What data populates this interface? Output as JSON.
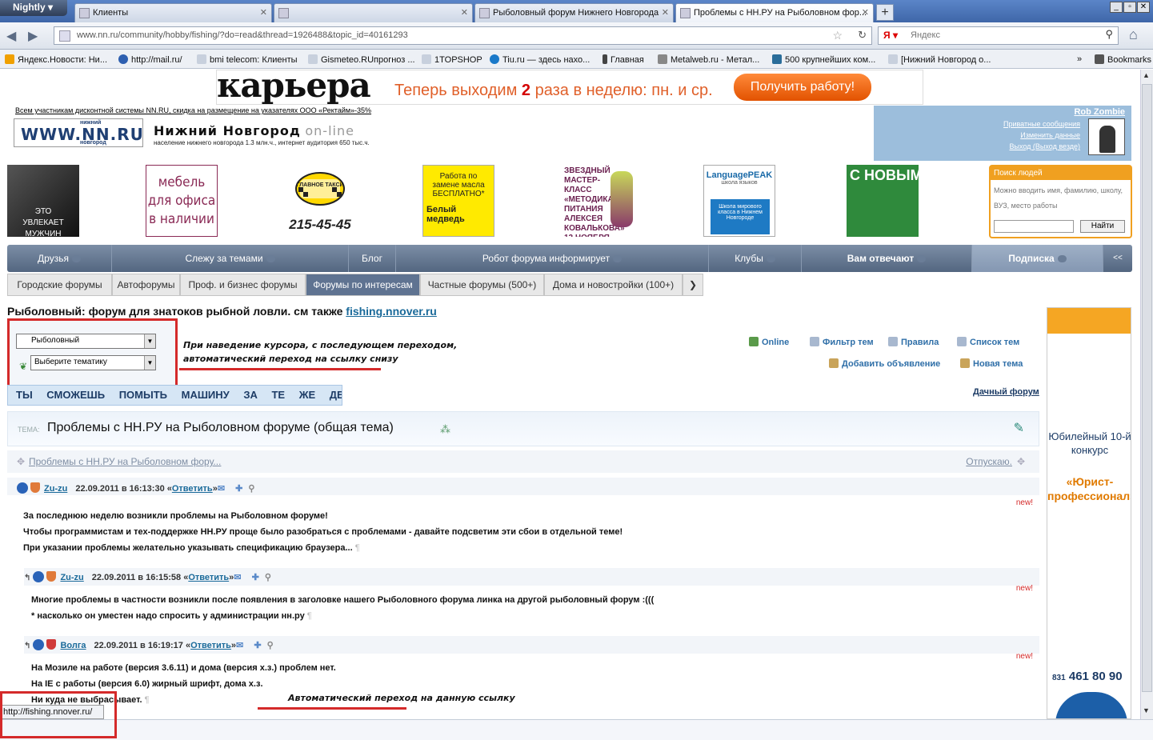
{
  "browser": {
    "brand": "Nightly",
    "tabs": [
      {
        "label": "Клиенты"
      },
      {
        "label": ""
      },
      {
        "label": "Рыболовный форум Нижнего Новгорода"
      },
      {
        "label": "Проблемы с НН.РУ на Рыболовном фор..."
      }
    ],
    "url": "www.nn.ru/community/hobby/fishing/?do=read&thread=1926488&topic_id=40161293",
    "search_placeholder": "Яндекс",
    "bookmarks": [
      "Яндекс.Новости: Ни...",
      "http://mail.ru/",
      "bmi telecom: Клиенты",
      "Gismeteo.RUпрогноз ...",
      "1TOPSHOP",
      "Tiu.ru — здесь нахо...",
      "Главная",
      "Metalweb.ru - Метал...",
      "500 крупнейших ком...",
      "[Нижний Новгород о..."
    ],
    "bookmarks_menu": "Bookmarks",
    "status_url": "http://fishing.nnover.ru/"
  },
  "banner": {
    "logo": "карьера",
    "slogan_pre": "Теперь выходим ",
    "slogan_num": "2",
    "slogan_post": " раза в неделю: пн. и ср.",
    "cta": "Получить работу!"
  },
  "site": {
    "discount": "Всем участникам дисконтной системы NN.RU, скидка на размещение на указателях ООО «Ректайм»-35%",
    "logo": "WWW.NN.RU",
    "logo_top": "нижний",
    "logo_bottom": "новгород",
    "city": "Нижний Новгород",
    "online": "on-line",
    "info": "население нижнего новгорода 1.3 млн.ч., интернет аудитория 650 тыс.ч."
  },
  "user": {
    "name": "Rob Zombie",
    "links": [
      "Приватные сообщения",
      "Изменить данные",
      "Выход (Выход везде)"
    ]
  },
  "ads": {
    "man": "ЭТО\nУВЛЕКАЕТ МУЖЧИН",
    "furniture": "мебель для офиса в наличии",
    "taxi_phone": "215-45-45",
    "taxi_label": "ГЛАВНОЕ ТАКСИ",
    "oil": "Работа по замене масла БЕСПЛАТНО*",
    "oil_brand": "Белый медведь",
    "star": "ЗВЕЗДНЫЙ МАСТЕР-КЛАСС «МЕТОДИКА ПИТАНИЯ АЛЕКСЕЯ КОВАЛЬКОВА» 12 НОЯБРЯ",
    "lang_brand": "LanguagePEAK",
    "lang_sub": "школа языков",
    "lang_body": "Школа мирового класса в Нижнем Новгороде",
    "newyear": "С НОВЫМ"
  },
  "people_search": {
    "title": "Поиск людей",
    "hint": "Можно вводить имя, фамилию, школу, ВУЗ, место работы",
    "button": "Найти"
  },
  "menu1": [
    "Друзья",
    "Слежу за темами",
    "Блог",
    "Робот форума информирует",
    "Клубы",
    "Вам отвечают",
    "Подписка",
    "<<"
  ],
  "menu2": [
    "Городские форумы",
    "Автофорумы",
    "Проф. и бизнес форумы",
    "Форумы по интересам",
    "Частные форумы (500+)",
    "Дома и новостройки (100+)"
  ],
  "forum": {
    "title": "Рыболовный: форум для знатоков рыбной ловли. см также ",
    "title_link": "fishing.nnover.ru",
    "select_forum": "Рыболовный",
    "select_topic": "Выберите тематику",
    "tools": [
      "Online",
      "Фильтр тем",
      "Правила",
      "Список тем",
      "Добавить объявление",
      "Новая тема"
    ],
    "marquee": "ТЫ СМОЖЕШЬ ПОМЫТЬ МАШИНУ ЗА ТЕ ЖЕ ДЕНЬГИ",
    "dacha": "Дачный форум",
    "topic_label": "ТЕМА:",
    "topic": "Проблемы с НН.РУ на Рыболовном форуме (общая тема)",
    "crumb": "Проблемы с НН.РУ на Рыболовном фору...",
    "crumb_right": "Отпускаю."
  },
  "annotations": {
    "hover_note_1": "При наведение курсора, с последующем переходом,",
    "hover_note_2": "автоматический переход на ссылку снизу",
    "auto_note": "Автоматический переход на данную ссылку"
  },
  "posts": [
    {
      "user": "Zu-zu",
      "date": "22.09.2011 в 16:13:30 «",
      "reply": "Ответить",
      "new": "new!",
      "lines": [
        "За последнюю неделю возникли проблемы на Рыболовном форуме!",
        "Чтобы программистам и тех-поддержке НН.РУ проще было разобраться с проблемами - давайте подсветим эти сбои в отдельной теме!",
        "При указании проблемы желательно указывать спецификацию браузера..."
      ]
    },
    {
      "user": "Zu-zu",
      "date": "22.09.2011 в 16:15:58 «",
      "reply": "Ответить",
      "new": "new!",
      "lines": [
        "Многие проблемы в частности возникли после появления в заголовке нашего Рыболовного форума линка на другой рыболовный форум :(((",
        "* насколько он уместен надо спросить у администрации нн.ру"
      ]
    },
    {
      "user": "Волга",
      "date": "22.09.2011 в 16:19:17 «",
      "reply": "Ответить",
      "new": "new!",
      "lines": [
        "На Мозиле на работе (версия 3.6.11) и дома (версия х.з.) проблем нет.",
        "На IE с работы (версия 6.0) жирный шрифт, дома х.з.",
        "Ни куда не выбрасывает."
      ]
    }
  ],
  "side_ad": {
    "line1": "Юбилейный 10-й конкурс",
    "line2": "«Юрист-профессионал»",
    "phone_code": "831",
    "phone": "461 80 90"
  }
}
